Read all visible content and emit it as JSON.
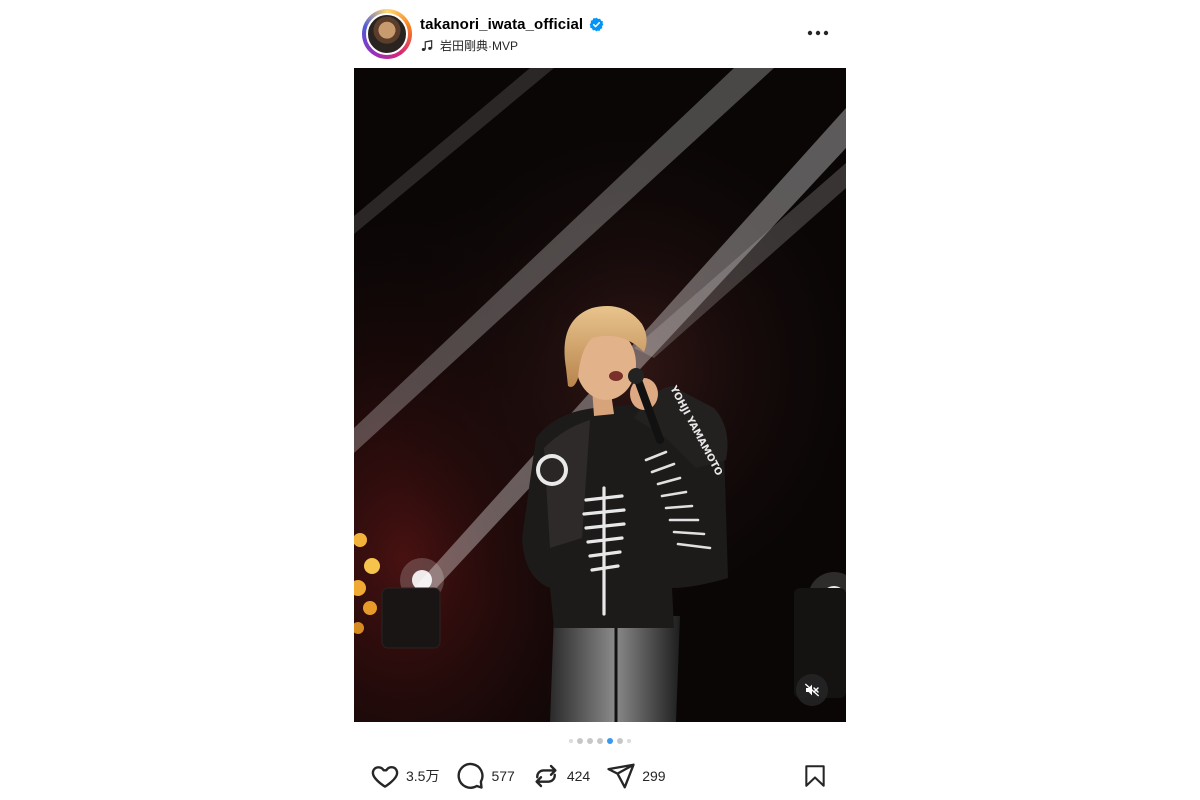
{
  "header": {
    "username": "takanori_iwata_official",
    "music_artist": "岩田剛典",
    "music_separator": " · ",
    "music_title": "MVP",
    "verified_icon": "verified-badge-icon",
    "more_icon": "more-horizontal-icon"
  },
  "media": {
    "description_icon": "concert-photo",
    "jacket_text": "YOHJI YAMAMOTO",
    "mute_icon": "speaker-muted-icon"
  },
  "carousel": {
    "total_visible_dots": 7,
    "active_index": 4
  },
  "actions": {
    "likes": "3.5万",
    "comments": "577",
    "reposts": "424",
    "shares": "299"
  },
  "colors": {
    "accent": "#3897f0",
    "verified": "#0095f6",
    "text": "#262626"
  }
}
